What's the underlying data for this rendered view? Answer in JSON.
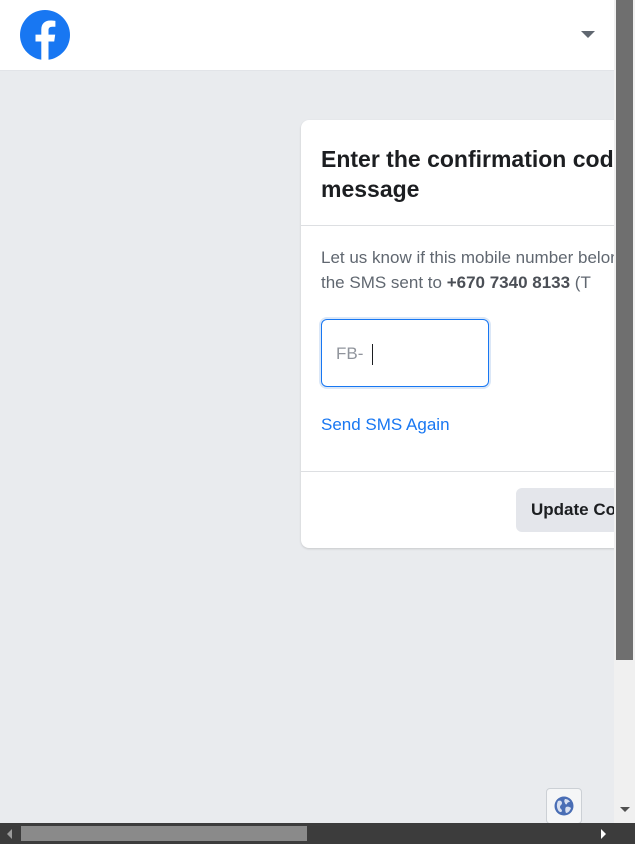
{
  "header": {
    "logo_icon": "facebook-logo-icon",
    "menu_icon": "caret-down-icon"
  },
  "card": {
    "title": "Enter the confirmation code from the text message",
    "description_prefix": "Let us know if this mobile number belongs to you. Enter the code in",
    "description_middle": "the SMS sent to",
    "phone_number": "+670 7340 8133",
    "description_suffix": " (T",
    "code_prefix": "FB-",
    "code_value": "",
    "resend_link": "Send SMS Again",
    "update_button": "Update Contact Info"
  },
  "footer": {
    "language_icon": "globe-icon"
  },
  "colors": {
    "brand_blue": "#1877f2",
    "page_background": "#e9ebee",
    "card_background": "#ffffff",
    "button_gray": "#e4e6eb"
  }
}
